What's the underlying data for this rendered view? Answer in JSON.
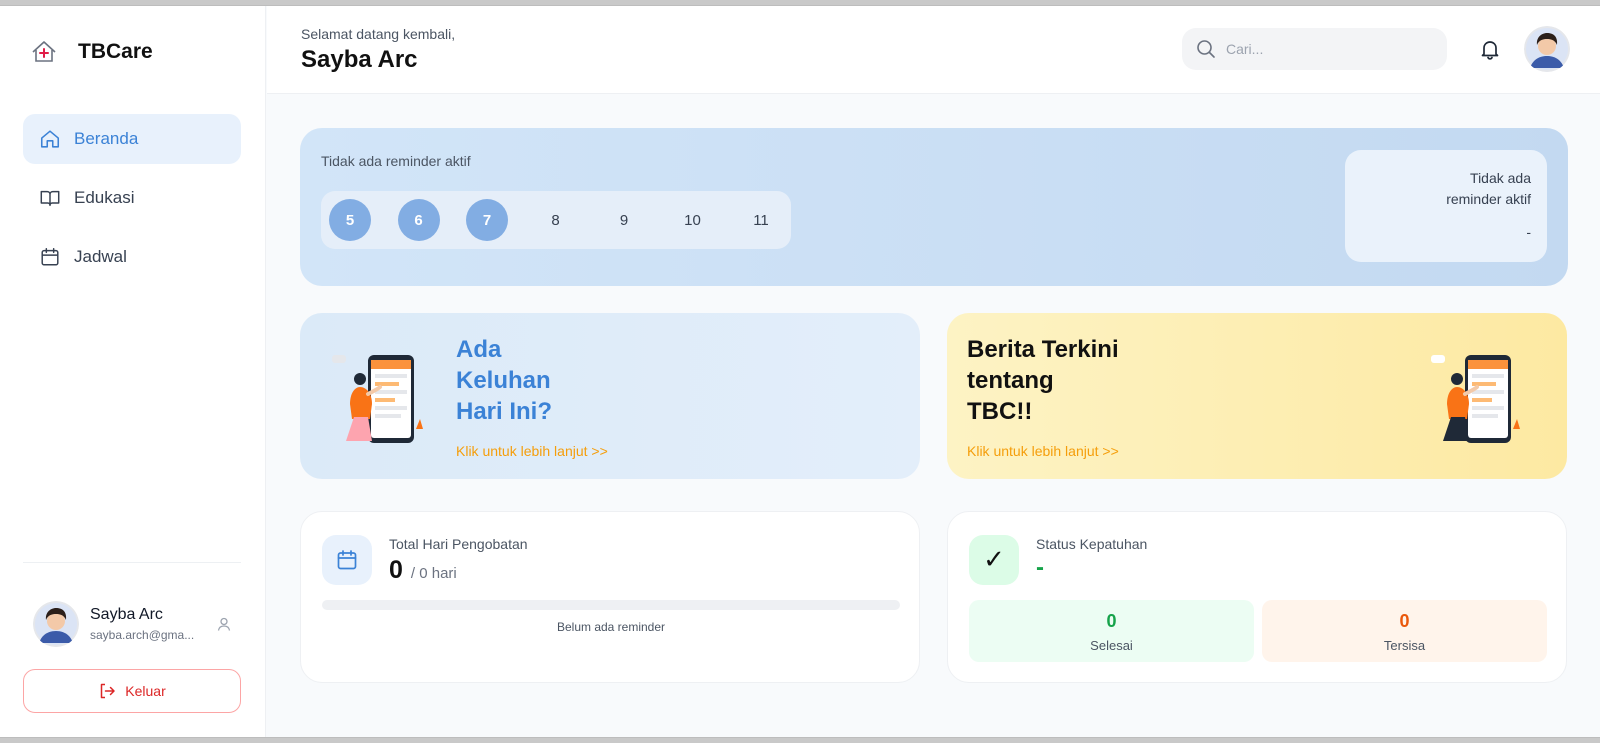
{
  "app": {
    "name": "TBCare"
  },
  "sidebar": {
    "items": [
      {
        "label": "Beranda",
        "active": true
      },
      {
        "label": "Edukasi",
        "active": false
      },
      {
        "label": "Jadwal",
        "active": false
      }
    ],
    "profile": {
      "name": "Sayba Arc",
      "email": "sayba.arch@gma..."
    },
    "logout_label": "Keluar"
  },
  "header": {
    "greeting": "Selamat datang kembali,",
    "user_name": "Sayba Arc",
    "search_placeholder": "Cari..."
  },
  "reminder": {
    "title": "Tidak ada reminder aktif",
    "days": [
      {
        "label": "5",
        "active": true
      },
      {
        "label": "6",
        "active": true
      },
      {
        "label": "7",
        "active": true
      },
      {
        "label": "8",
        "active": false
      },
      {
        "label": "9",
        "active": false
      },
      {
        "label": "10",
        "active": false
      },
      {
        "label": "11",
        "active": false
      }
    ],
    "card_line1": "Tidak ada",
    "card_line2": "reminder aktif",
    "card_value": "-"
  },
  "promos": {
    "complaint": {
      "line1": "Ada",
      "line2": "Keluhan",
      "line3": "Hari Ini?",
      "link": "Klik untuk lebih lanjut >>"
    },
    "news": {
      "line1": "Berita Terkini",
      "line2": "tentang",
      "line3": "TBC!!",
      "link": "Klik untuk lebih lanjut >>"
    }
  },
  "treatment": {
    "label": "Total Hari Pengobatan",
    "value": "0",
    "suffix": "/ 0 hari",
    "progress": 0,
    "note": "Belum ada reminder"
  },
  "compliance": {
    "label": "Status Kepatuhan",
    "value": "-",
    "check_glyph": "✓",
    "done": {
      "value": "0",
      "label": "Selesai"
    },
    "remaining": {
      "value": "0",
      "label": "Tersisa"
    }
  },
  "colors": {
    "accent": "#3b82d6",
    "day_active": "#82ade3",
    "link": "#f59e0b",
    "success": "#16a34a",
    "warning": "#ea580c",
    "danger": "#dc2626"
  }
}
